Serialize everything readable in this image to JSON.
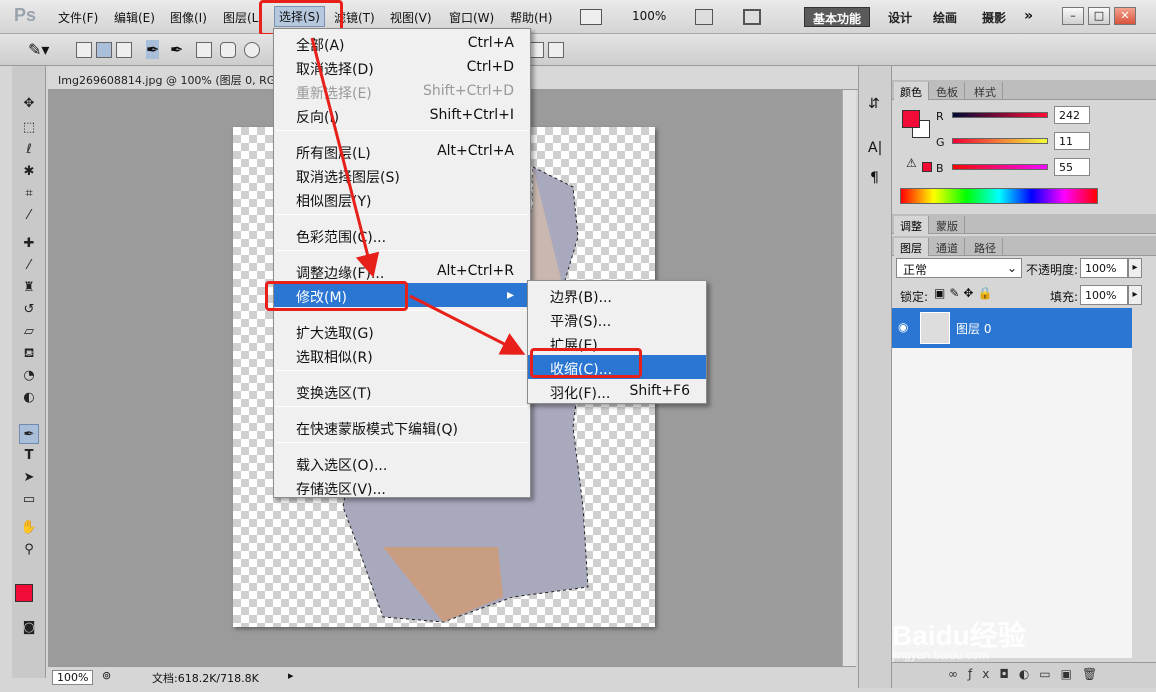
{
  "app": {
    "logo_text": "Ps"
  },
  "menubar": {
    "items": [
      "文件(F)",
      "编辑(E)",
      "图像(I)",
      "图层(L)",
      "选择(S)",
      "滤镜(T)",
      "视图(V)",
      "窗口(W)",
      "帮助(H)"
    ],
    "zoom": "100%",
    "workspaces": [
      "基本功能",
      "设计",
      "绘画",
      "摄影"
    ]
  },
  "document": {
    "tab_title": "Img269608814.jpg @ 100% (图层 0, RG",
    "zoom": "100%",
    "status": "文档:618.2K/718.8K"
  },
  "select_menu": {
    "groups": [
      [
        {
          "label": "全部(A)",
          "shortcut": "Ctrl+A",
          "disabled": false
        },
        {
          "label": "取消选择(D)",
          "shortcut": "Ctrl+D",
          "disabled": false
        },
        {
          "label": "重新选择(E)",
          "shortcut": "Shift+Ctrl+D",
          "disabled": true
        },
        {
          "label": "反向(I)",
          "shortcut": "Shift+Ctrl+I",
          "disabled": false
        }
      ],
      [
        {
          "label": "所有图层(L)",
          "shortcut": "Alt+Ctrl+A",
          "disabled": false
        },
        {
          "label": "取消选择图层(S)",
          "shortcut": "",
          "disabled": false
        },
        {
          "label": "相似图层(Y)",
          "shortcut": "",
          "disabled": false
        }
      ],
      [
        {
          "label": "色彩范围(C)...",
          "shortcut": "",
          "disabled": false
        }
      ],
      [
        {
          "label": "调整边缘(F)...",
          "shortcut": "Alt+Ctrl+R",
          "disabled": false
        },
        {
          "label": "修改(M)",
          "shortcut": "",
          "disabled": false,
          "submenu": true
        }
      ],
      [
        {
          "label": "扩大选取(G)",
          "shortcut": "",
          "disabled": false
        },
        {
          "label": "选取相似(R)",
          "shortcut": "",
          "disabled": false
        }
      ],
      [
        {
          "label": "变换选区(T)",
          "shortcut": "",
          "disabled": false
        }
      ],
      [
        {
          "label": "在快速蒙版模式下编辑(Q)",
          "shortcut": "",
          "disabled": false
        }
      ],
      [
        {
          "label": "载入选区(O)...",
          "shortcut": "",
          "disabled": false
        },
        {
          "label": "存储选区(V)...",
          "shortcut": "",
          "disabled": false
        }
      ]
    ]
  },
  "modify_submenu": {
    "items": [
      {
        "label": "边界(B)...",
        "shortcut": ""
      },
      {
        "label": "平滑(S)...",
        "shortcut": ""
      },
      {
        "label": "扩展(E)...",
        "shortcut": ""
      },
      {
        "label": "收缩(C)...",
        "shortcut": ""
      },
      {
        "label": "羽化(F)...",
        "shortcut": "Shift+F6"
      }
    ]
  },
  "color_panel": {
    "tabs": [
      "颜色",
      "色板",
      "样式"
    ],
    "channels": [
      {
        "name": "R",
        "value": "242"
      },
      {
        "name": "G",
        "value": "11"
      },
      {
        "name": "B",
        "value": "55"
      }
    ],
    "foreground": "#f20b37"
  },
  "adjust_tabs": [
    "调整",
    "蒙版"
  ],
  "layers_panel": {
    "tabs": [
      "图层",
      "通道",
      "路径"
    ],
    "blend_mode": "正常",
    "opacity_label": "不透明度:",
    "opacity": "100%",
    "lock_label": "锁定:",
    "fill_label": "填充:",
    "fill": "100%",
    "layer_name": "图层 0"
  },
  "watermark": {
    "brand": "Baidu经验",
    "url": "jingyan.baidu.com"
  },
  "colors": {
    "highlight": "#2a76d2",
    "annotation_red": "#e8201a"
  }
}
